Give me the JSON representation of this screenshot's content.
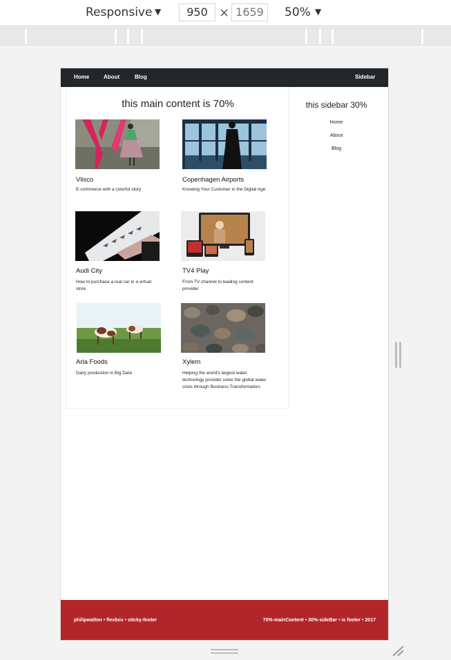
{
  "devtools": {
    "mode": "Responsive",
    "width": "950",
    "height": "1659",
    "times": "×",
    "zoom": "50%",
    "caret": "▼"
  },
  "nav": {
    "home": "Home",
    "about": "About",
    "blog": "Blog",
    "sidebar": "Sidebar"
  },
  "main": {
    "title": "this main content is 70%",
    "cards": [
      {
        "title": "Vlisco",
        "desc": "E-commerce with a colorful story"
      },
      {
        "title": "Copenhagen Airports",
        "desc": "Knowing Your Customer in the Digital Age"
      },
      {
        "title": "Audi City",
        "desc": "How to purchase a real car in a virtual store"
      },
      {
        "title": "TV4 Play",
        "desc": "From TV channel to leading content provider"
      },
      {
        "title": "Arla Foods",
        "desc": "Dairy production in Big Data"
      },
      {
        "title": "Xylem",
        "desc": "Helping the world's largest water technology provider solve the global water crisis through Business Transformation."
      }
    ]
  },
  "sidebar": {
    "title": "this sidebar 30%",
    "links": [
      "Home",
      "About",
      "Blog"
    ]
  },
  "footer": {
    "left": "philipwalton • flexbox • sticky-footer",
    "right": "70%-mainContent • 30%-sideBar • is footer • 2017"
  },
  "colors": {
    "nav_bg": "#232729",
    "footer_bg": "#b22629"
  }
}
